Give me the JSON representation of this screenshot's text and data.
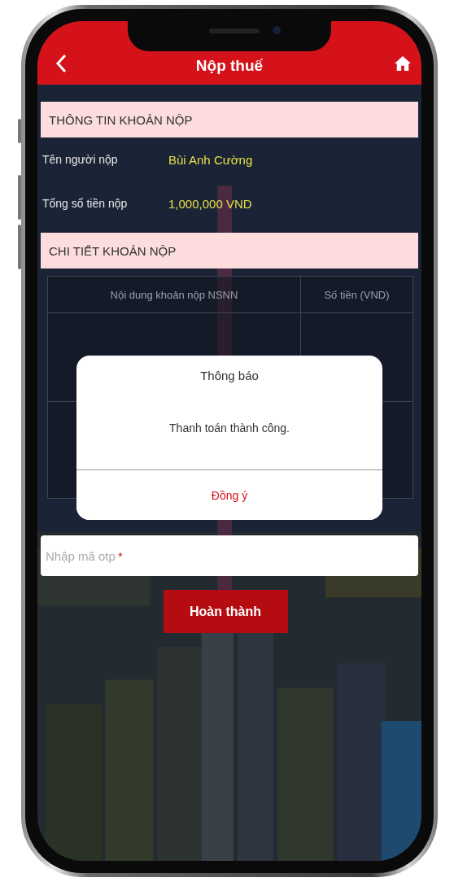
{
  "header": {
    "title": "Nộp thuế"
  },
  "payment_info": {
    "heading": "THÔNG TIN KHOẢN NỘP",
    "rows": [
      {
        "label": "Tên người nộp",
        "value": "Bùi Anh Cường"
      },
      {
        "label": "Tổng số tiền nộp",
        "value": "1,000,000 VND"
      }
    ]
  },
  "payment_details": {
    "heading": "CHI TIẾT KHOẢN NỘP",
    "table": {
      "columns": [
        "Nội dung khoản nộp NSNN",
        "Số tiền (VND)"
      ]
    }
  },
  "otp_field": {
    "placeholder": "Nhập mã otp",
    "required_mark": "*"
  },
  "submit_button": "Hoàn thành",
  "dialog": {
    "title": "Thông báo",
    "message": "Thanh toán thành công.",
    "button": "Đồng ý"
  }
}
